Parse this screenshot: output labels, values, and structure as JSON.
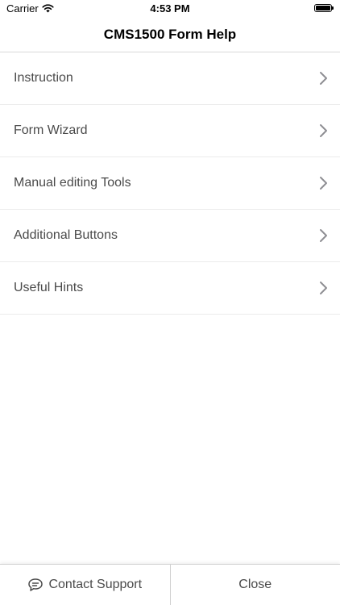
{
  "status_bar": {
    "carrier": "Carrier",
    "time": "4:53 PM"
  },
  "nav": {
    "title": "CMS1500 Form Help"
  },
  "menu": {
    "items": [
      {
        "label": "Instruction"
      },
      {
        "label": "Form Wizard"
      },
      {
        "label": "Manual editing Tools"
      },
      {
        "label": "Additional Buttons"
      },
      {
        "label": "Useful Hints"
      }
    ]
  },
  "footer": {
    "contact_label": "Contact Support",
    "close_label": "Close"
  },
  "icons": {
    "wifi": "wifi-icon",
    "battery": "battery-icon",
    "chevron": "chevron-right-icon",
    "chat": "chat-bubble-icon"
  },
  "colors": {
    "text_primary": "#000000",
    "text_item": "#4a4a4a",
    "chevron": "#8e8e93",
    "divider": "#ececec"
  }
}
